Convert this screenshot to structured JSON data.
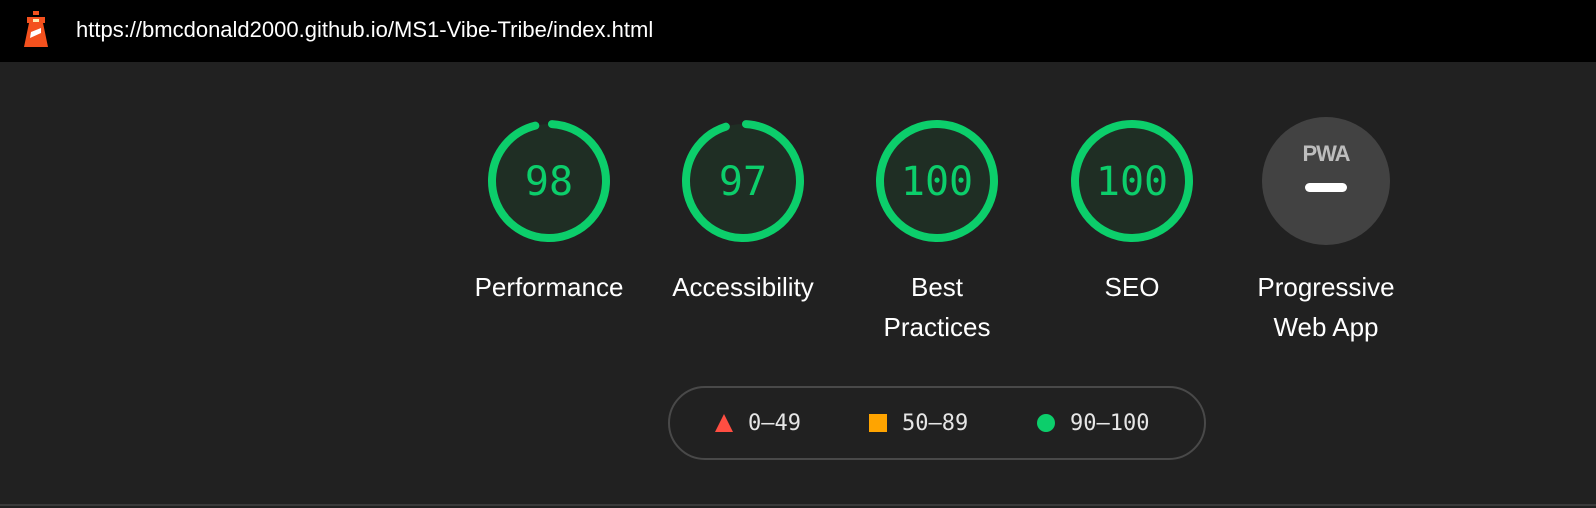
{
  "header": {
    "url": "https://bmcdonald2000.github.io/MS1-Vibe-Tribe/index.html",
    "logo_icon": "lighthouse-icon"
  },
  "scores": [
    {
      "value": "98",
      "fraction": 0.98,
      "label": "Performance",
      "color": "#0cce6b"
    },
    {
      "value": "97",
      "fraction": 0.97,
      "label": "Accessibility",
      "color": "#0cce6b"
    },
    {
      "value": "100",
      "fraction": 1.0,
      "label": "Best Practices",
      "color": "#0cce6b"
    },
    {
      "value": "100",
      "fraction": 1.0,
      "label": "SEO",
      "color": "#0cce6b"
    }
  ],
  "pwa": {
    "badge_text": "PWA",
    "label": "Progressive Web App",
    "icon": "pwa-badge-icon"
  },
  "legend": [
    {
      "range": "0–49",
      "shape": "triangle",
      "color": "#ff4e42"
    },
    {
      "range": "50–89",
      "shape": "square",
      "color": "#ffa400"
    },
    {
      "range": "90–100",
      "shape": "circle",
      "color": "#0cce6b"
    }
  ],
  "colors": {
    "pass": "#0cce6b",
    "gauge_fill": "#1f2e24",
    "background": "#212121",
    "pwa_fill": "#424242"
  }
}
